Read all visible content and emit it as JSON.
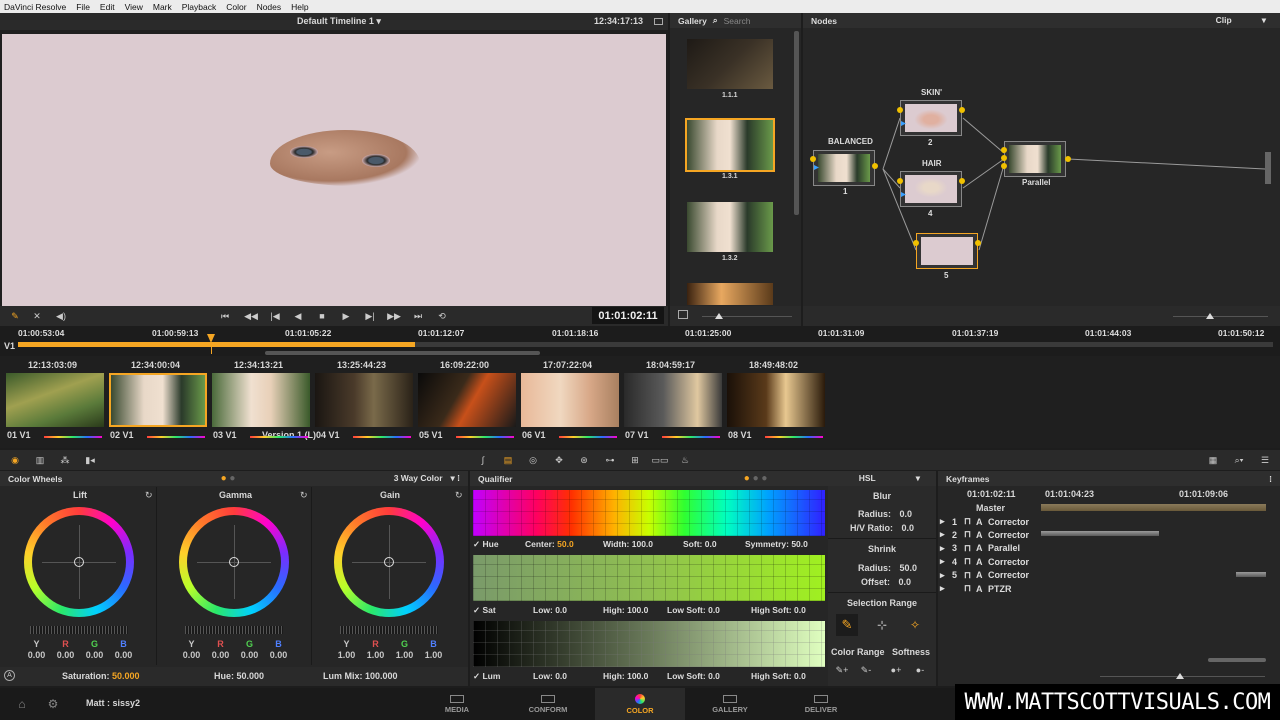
{
  "menu": {
    "items": [
      "DaVinci Resolve",
      "File",
      "Edit",
      "View",
      "Mark",
      "Playback",
      "Color",
      "Nodes",
      "Help"
    ]
  },
  "viewer": {
    "timeline_name": "Default Timeline 1 ▾",
    "timecode_top": "12:34:17:13",
    "timecode_bottom": "01:01:02:11"
  },
  "gallery": {
    "title": "Gallery",
    "search_placeholder": "Search",
    "stills": [
      "1.1.1",
      "1.3.1",
      "1.3.2"
    ]
  },
  "nodes": {
    "title": "Nodes",
    "mode": "Clip",
    "items": [
      {
        "label": "BALANCED",
        "num": "1"
      },
      {
        "label": "SKIN'",
        "num": "2"
      },
      {
        "label": "HAIR",
        "num": "4"
      },
      {
        "label": "",
        "num": "5"
      },
      {
        "label": "Parallel",
        "num": ""
      }
    ]
  },
  "timeline": {
    "track": "V1",
    "ticks": [
      "01:00:53:04",
      "01:00:59:13",
      "01:01:05:22",
      "01:01:12:07",
      "01:01:18:16",
      "01:01:25:00",
      "01:01:31:09",
      "01:01:37:19",
      "01:01:44:03",
      "01:01:50:12"
    ]
  },
  "clips": [
    {
      "tc": "12:13:03:09",
      "label": "01 V1",
      "extra": ""
    },
    {
      "tc": "12:34:00:04",
      "label": "02 V1",
      "extra": ""
    },
    {
      "tc": "12:34:13:21",
      "label": "03 V1",
      "extra": "Version 1 (L)"
    },
    {
      "tc": "13:25:44:23",
      "label": "04 V1",
      "extra": ""
    },
    {
      "tc": "16:09:22:00",
      "label": "05 V1",
      "extra": ""
    },
    {
      "tc": "17:07:22:04",
      "label": "06 V1",
      "extra": ""
    },
    {
      "tc": "18:04:59:17",
      "label": "07 V1",
      "extra": ""
    },
    {
      "tc": "18:49:48:02",
      "label": "08 V1",
      "extra": ""
    }
  ],
  "wheels": {
    "title": "Color Wheels",
    "mode": "3 Way Color",
    "headers": {
      "y": "Y",
      "r": "R",
      "g": "G",
      "b": "B"
    },
    "lift": {
      "name": "Lift",
      "y": "0.00",
      "r": "0.00",
      "g": "0.00",
      "b": "0.00"
    },
    "gamma": {
      "name": "Gamma",
      "y": "0.00",
      "r": "0.00",
      "g": "0.00",
      "b": "0.00"
    },
    "gain": {
      "name": "Gain",
      "y": "1.00",
      "r": "1.00",
      "g": "1.00",
      "b": "1.00"
    },
    "saturation_label": "Saturation:",
    "saturation": "50.000",
    "hue_label": "Hue:",
    "hue": "50.000",
    "lummix_label": "Lum Mix:",
    "lummix": "100.000"
  },
  "qualifier": {
    "title": "Qualifier",
    "mode": "HSL",
    "hue": {
      "name": "Hue",
      "center_label": "Center:",
      "center": "50.0",
      "width_label": "Width:",
      "width": "100.0",
      "soft_label": "Soft:",
      "soft": "0.0",
      "sym_label": "Symmetry:",
      "sym": "50.0"
    },
    "sat": {
      "name": "Sat",
      "low_label": "Low:",
      "low": "0.0",
      "high_label": "High:",
      "high": "100.0",
      "lsoft_label": "Low Soft:",
      "lsoft": "0.0",
      "hsoft_label": "High Soft:",
      "hsoft": "0.0"
    },
    "lum": {
      "name": "Lum",
      "low_label": "Low:",
      "low": "0.0",
      "high_label": "High:",
      "high": "100.0",
      "lsoft_label": "Low Soft:",
      "lsoft": "0.0",
      "hsoft_label": "High Soft:",
      "hsoft": "0.0"
    },
    "blur_title": "Blur",
    "radius_label": "Radius:",
    "radius": "0.0",
    "hv_label": "H/V Ratio:",
    "hv": "0.0",
    "shrink_title": "Shrink",
    "shrink_radius": "50.0",
    "offset_label": "Offset:",
    "offset": "0.0",
    "selection_range": "Selection Range",
    "color_range": "Color Range",
    "softness": "Softness"
  },
  "keyframes": {
    "title": "Keyframes",
    "tc1": "01:01:02:11",
    "tc2": "01:01:04:23",
    "tc3": "01:01:09:06",
    "master": "Master",
    "rows": [
      {
        "num": "1",
        "name": "Corrector"
      },
      {
        "num": "2",
        "name": "Corrector"
      },
      {
        "num": "3",
        "name": "Parallel"
      },
      {
        "num": "4",
        "name": "Corrector"
      },
      {
        "num": "5",
        "name": "Corrector"
      },
      {
        "num": "",
        "name": "PTZR"
      }
    ]
  },
  "footer": {
    "user": "Matt : sissy2",
    "tabs": [
      "MEDIA",
      "CONFORM",
      "COLOR",
      "GALLERY",
      "DELIVER"
    ],
    "active": "COLOR",
    "watermark": "WWW.MATTSCOTTVISUALS.COM"
  },
  "colors": {
    "accent": "#f5a623",
    "active_tab": "#f5a623",
    "skin_bg": "#dccbd0"
  }
}
